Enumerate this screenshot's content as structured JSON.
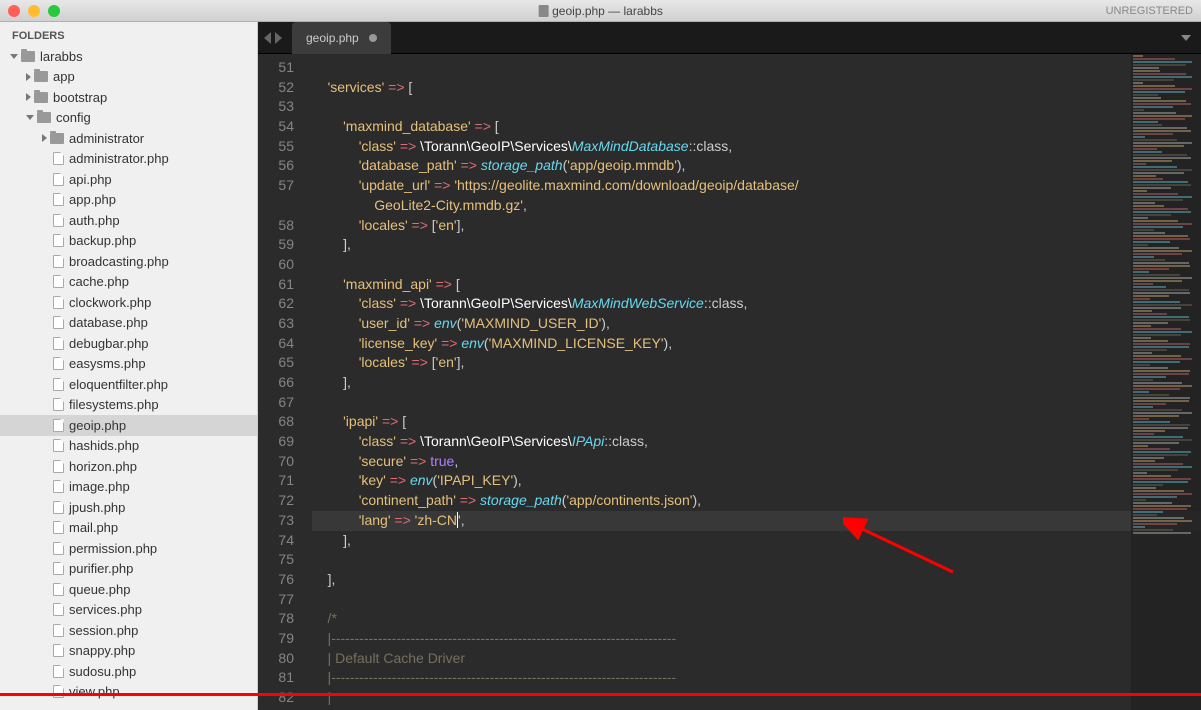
{
  "titlebar": {
    "title": "geoip.php — larabbs",
    "unreg": "UNREGISTERED"
  },
  "sidebar": {
    "header": "FOLDERS",
    "root": "larabbs",
    "folders_l1": [
      "app",
      "bootstrap"
    ],
    "config_label": "config",
    "admin_folder": "administrator",
    "files": [
      "administrator.php",
      "api.php",
      "app.php",
      "auth.php",
      "backup.php",
      "broadcasting.php",
      "cache.php",
      "clockwork.php",
      "database.php",
      "debugbar.php",
      "easysms.php",
      "eloquentfilter.php",
      "filesystems.php",
      "geoip.php",
      "hashids.php",
      "horizon.php",
      "image.php",
      "jpush.php",
      "mail.php",
      "permission.php",
      "purifier.php",
      "queue.php",
      "services.php",
      "session.php",
      "snappy.php",
      "sudosu.php",
      "view.php"
    ],
    "selected_file": "geoip.php"
  },
  "tab": {
    "name": "geoip.php"
  },
  "code": {
    "lines": [
      {
        "n": 51,
        "t": ""
      },
      {
        "n": 52,
        "t": "    'services' => ["
      },
      {
        "n": 53,
        "t": ""
      },
      {
        "n": 54,
        "t": "        'maxmind_database' => ["
      },
      {
        "n": 55,
        "t": "            'class' => \\Torann\\GeoIP\\Services\\MaxMindDatabase::class,"
      },
      {
        "n": 56,
        "t": "            'database_path' => storage_path('app/geoip.mmdb'),"
      },
      {
        "n": 57,
        "t": "            'update_url' => 'https://geolite.maxmind.com/download/geoip/database/GeoLite2-City.mmdb.gz',"
      },
      {
        "n": 58,
        "t": "            'locales' => ['en'],"
      },
      {
        "n": 59,
        "t": "        ],"
      },
      {
        "n": 60,
        "t": ""
      },
      {
        "n": 61,
        "t": "        'maxmind_api' => ["
      },
      {
        "n": 62,
        "t": "            'class' => \\Torann\\GeoIP\\Services\\MaxMindWebService::class,"
      },
      {
        "n": 63,
        "t": "            'user_id' => env('MAXMIND_USER_ID'),"
      },
      {
        "n": 64,
        "t": "            'license_key' => env('MAXMIND_LICENSE_KEY'),"
      },
      {
        "n": 65,
        "t": "            'locales' => ['en'],"
      },
      {
        "n": 66,
        "t": "        ],"
      },
      {
        "n": 67,
        "t": ""
      },
      {
        "n": 68,
        "t": "        'ipapi' => ["
      },
      {
        "n": 69,
        "t": "            'class' => \\Torann\\GeoIP\\Services\\IPApi::class,"
      },
      {
        "n": 70,
        "t": "            'secure' => true,"
      },
      {
        "n": 71,
        "t": "            'key' => env('IPAPI_KEY'),"
      },
      {
        "n": 72,
        "t": "            'continent_path' => storage_path('app/continents.json'),"
      },
      {
        "n": 73,
        "t": "            'lang' => 'zh-CN',"
      },
      {
        "n": 74,
        "t": "        ],"
      },
      {
        "n": 75,
        "t": ""
      },
      {
        "n": 76,
        "t": "    ],"
      },
      {
        "n": 77,
        "t": ""
      },
      {
        "n": 78,
        "t": "    /*"
      },
      {
        "n": 79,
        "t": "    |--------------------------------------------------------------------------"
      },
      {
        "n": 80,
        "t": "    | Default Cache Driver"
      },
      {
        "n": 81,
        "t": "    |--------------------------------------------------------------------------"
      },
      {
        "n": 82,
        "t": "    |"
      }
    ]
  }
}
